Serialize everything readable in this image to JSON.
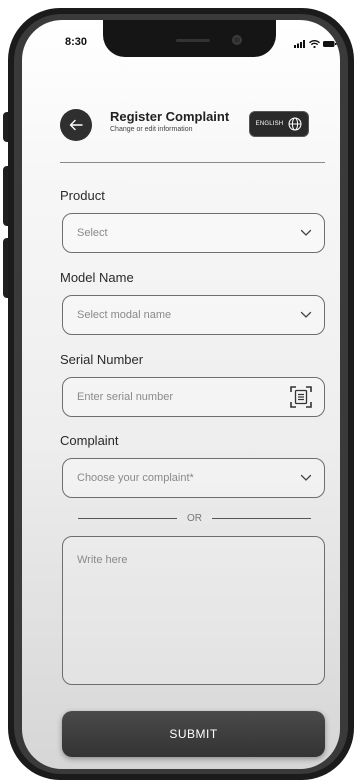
{
  "status_bar": {
    "time": "8:30"
  },
  "header": {
    "title": "Register Complaint",
    "subtitle": "Change or edit information",
    "language_label": "ENGLISH",
    "back_icon": "arrow-left-icon",
    "language_icon": "globe-icon"
  },
  "form": {
    "product": {
      "label": "Product",
      "placeholder": "Select"
    },
    "model_name": {
      "label": "Model Name",
      "placeholder": "Select modal name"
    },
    "serial_number": {
      "label": "Serial Number",
      "placeholder": "Enter serial number",
      "scan_icon": "scan-icon"
    },
    "complaint": {
      "label": "Complaint",
      "placeholder": "Choose your complaint*"
    },
    "separator": "OR",
    "description": {
      "placeholder": "Write here"
    },
    "submit_label": "SUBMIT"
  },
  "colors": {
    "dark": "#2f2f2f",
    "border": "#6e6e6e",
    "placeholder": "#8a8a8a",
    "background_top": "#ffffff",
    "background_bottom": "#d6d6d6"
  }
}
